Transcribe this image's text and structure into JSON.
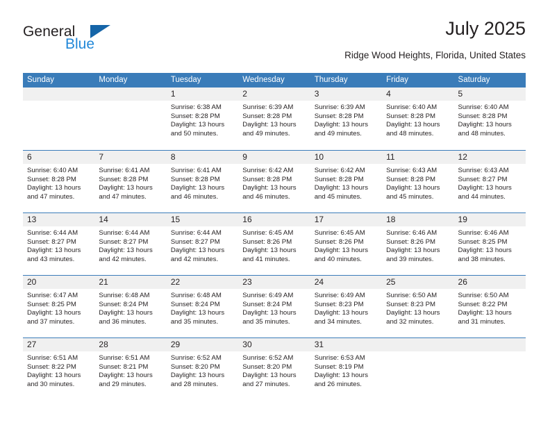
{
  "brand": {
    "name_top": "General",
    "name_bottom": "Blue",
    "triangle_color": "#1565a8",
    "blue_color": "#2288d8"
  },
  "header": {
    "title": "July 2025",
    "subtitle": "Ridge Wood Heights, Florida, United States"
  },
  "theme": {
    "header_blue": "#3a7cb9",
    "day_band_gray": "#f0f0f0",
    "text": "#231f20"
  },
  "calendar": {
    "weekday_headers": [
      "Sunday",
      "Monday",
      "Tuesday",
      "Wednesday",
      "Thursday",
      "Friday",
      "Saturday"
    ],
    "weeks": [
      [
        {
          "day": "",
          "lines": []
        },
        {
          "day": "",
          "lines": []
        },
        {
          "day": "1",
          "lines": [
            "Sunrise: 6:38 AM",
            "Sunset: 8:28 PM",
            "Daylight: 13 hours",
            "and 50 minutes."
          ]
        },
        {
          "day": "2",
          "lines": [
            "Sunrise: 6:39 AM",
            "Sunset: 8:28 PM",
            "Daylight: 13 hours",
            "and 49 minutes."
          ]
        },
        {
          "day": "3",
          "lines": [
            "Sunrise: 6:39 AM",
            "Sunset: 8:28 PM",
            "Daylight: 13 hours",
            "and 49 minutes."
          ]
        },
        {
          "day": "4",
          "lines": [
            "Sunrise: 6:40 AM",
            "Sunset: 8:28 PM",
            "Daylight: 13 hours",
            "and 48 minutes."
          ]
        },
        {
          "day": "5",
          "lines": [
            "Sunrise: 6:40 AM",
            "Sunset: 8:28 PM",
            "Daylight: 13 hours",
            "and 48 minutes."
          ]
        }
      ],
      [
        {
          "day": "6",
          "lines": [
            "Sunrise: 6:40 AM",
            "Sunset: 8:28 PM",
            "Daylight: 13 hours",
            "and 47 minutes."
          ]
        },
        {
          "day": "7",
          "lines": [
            "Sunrise: 6:41 AM",
            "Sunset: 8:28 PM",
            "Daylight: 13 hours",
            "and 47 minutes."
          ]
        },
        {
          "day": "8",
          "lines": [
            "Sunrise: 6:41 AM",
            "Sunset: 8:28 PM",
            "Daylight: 13 hours",
            "and 46 minutes."
          ]
        },
        {
          "day": "9",
          "lines": [
            "Sunrise: 6:42 AM",
            "Sunset: 8:28 PM",
            "Daylight: 13 hours",
            "and 46 minutes."
          ]
        },
        {
          "day": "10",
          "lines": [
            "Sunrise: 6:42 AM",
            "Sunset: 8:28 PM",
            "Daylight: 13 hours",
            "and 45 minutes."
          ]
        },
        {
          "day": "11",
          "lines": [
            "Sunrise: 6:43 AM",
            "Sunset: 8:28 PM",
            "Daylight: 13 hours",
            "and 45 minutes."
          ]
        },
        {
          "day": "12",
          "lines": [
            "Sunrise: 6:43 AM",
            "Sunset: 8:27 PM",
            "Daylight: 13 hours",
            "and 44 minutes."
          ]
        }
      ],
      [
        {
          "day": "13",
          "lines": [
            "Sunrise: 6:44 AM",
            "Sunset: 8:27 PM",
            "Daylight: 13 hours",
            "and 43 minutes."
          ]
        },
        {
          "day": "14",
          "lines": [
            "Sunrise: 6:44 AM",
            "Sunset: 8:27 PM",
            "Daylight: 13 hours",
            "and 42 minutes."
          ]
        },
        {
          "day": "15",
          "lines": [
            "Sunrise: 6:44 AM",
            "Sunset: 8:27 PM",
            "Daylight: 13 hours",
            "and 42 minutes."
          ]
        },
        {
          "day": "16",
          "lines": [
            "Sunrise: 6:45 AM",
            "Sunset: 8:26 PM",
            "Daylight: 13 hours",
            "and 41 minutes."
          ]
        },
        {
          "day": "17",
          "lines": [
            "Sunrise: 6:45 AM",
            "Sunset: 8:26 PM",
            "Daylight: 13 hours",
            "and 40 minutes."
          ]
        },
        {
          "day": "18",
          "lines": [
            "Sunrise: 6:46 AM",
            "Sunset: 8:26 PM",
            "Daylight: 13 hours",
            "and 39 minutes."
          ]
        },
        {
          "day": "19",
          "lines": [
            "Sunrise: 6:46 AM",
            "Sunset: 8:25 PM",
            "Daylight: 13 hours",
            "and 38 minutes."
          ]
        }
      ],
      [
        {
          "day": "20",
          "lines": [
            "Sunrise: 6:47 AM",
            "Sunset: 8:25 PM",
            "Daylight: 13 hours",
            "and 37 minutes."
          ]
        },
        {
          "day": "21",
          "lines": [
            "Sunrise: 6:48 AM",
            "Sunset: 8:24 PM",
            "Daylight: 13 hours",
            "and 36 minutes."
          ]
        },
        {
          "day": "22",
          "lines": [
            "Sunrise: 6:48 AM",
            "Sunset: 8:24 PM",
            "Daylight: 13 hours",
            "and 35 minutes."
          ]
        },
        {
          "day": "23",
          "lines": [
            "Sunrise: 6:49 AM",
            "Sunset: 8:24 PM",
            "Daylight: 13 hours",
            "and 35 minutes."
          ]
        },
        {
          "day": "24",
          "lines": [
            "Sunrise: 6:49 AM",
            "Sunset: 8:23 PM",
            "Daylight: 13 hours",
            "and 34 minutes."
          ]
        },
        {
          "day": "25",
          "lines": [
            "Sunrise: 6:50 AM",
            "Sunset: 8:23 PM",
            "Daylight: 13 hours",
            "and 32 minutes."
          ]
        },
        {
          "day": "26",
          "lines": [
            "Sunrise: 6:50 AM",
            "Sunset: 8:22 PM",
            "Daylight: 13 hours",
            "and 31 minutes."
          ]
        }
      ],
      [
        {
          "day": "27",
          "lines": [
            "Sunrise: 6:51 AM",
            "Sunset: 8:22 PM",
            "Daylight: 13 hours",
            "and 30 minutes."
          ]
        },
        {
          "day": "28",
          "lines": [
            "Sunrise: 6:51 AM",
            "Sunset: 8:21 PM",
            "Daylight: 13 hours",
            "and 29 minutes."
          ]
        },
        {
          "day": "29",
          "lines": [
            "Sunrise: 6:52 AM",
            "Sunset: 8:20 PM",
            "Daylight: 13 hours",
            "and 28 minutes."
          ]
        },
        {
          "day": "30",
          "lines": [
            "Sunrise: 6:52 AM",
            "Sunset: 8:20 PM",
            "Daylight: 13 hours",
            "and 27 minutes."
          ]
        },
        {
          "day": "31",
          "lines": [
            "Sunrise: 6:53 AM",
            "Sunset: 8:19 PM",
            "Daylight: 13 hours",
            "and 26 minutes."
          ]
        },
        {
          "day": "",
          "lines": []
        },
        {
          "day": "",
          "lines": []
        }
      ]
    ]
  }
}
